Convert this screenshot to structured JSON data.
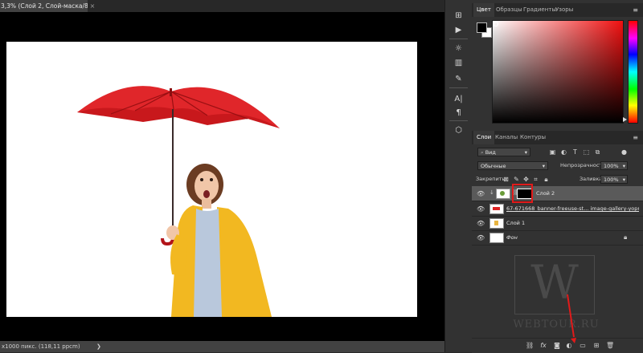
{
  "document": {
    "tab_title": "3,3% (Слой 2, Слой-маска/8) *",
    "close_symbol": "×",
    "status_text": "x1000 пикс. (118,11 ppcm)",
    "status_arrow": "❯"
  },
  "tool_dock": {
    "icons": [
      "history-icon",
      "play-action-icon",
      "adjustments-sun-icon",
      "histogram-icon",
      "brush-settings-icon",
      "character-A-icon",
      "paragraph-icon",
      "3d-cube-icon"
    ],
    "glyphs": {
      "history": "⊞",
      "play": "▶",
      "adjust": "☼",
      "histogram": "▥",
      "brush": "✎",
      "character": "A|",
      "paragraph": "¶",
      "cube": "⬡"
    }
  },
  "color_panel": {
    "tabs": [
      "Цвет",
      "Образцы",
      "Градиенты",
      "Узоры"
    ],
    "active_tab": "Цвет",
    "menu_symbol": "≡",
    "foreground_color": "#000000",
    "background_color": "#ffffff",
    "hue_color": "#f01010"
  },
  "layers_panel": {
    "tabs": [
      "Слои",
      "Каналы",
      "Контуры"
    ],
    "active_tab": "Слои",
    "menu_symbol": "≡",
    "filter_kind": "Вид",
    "blend_mode": "Обычные",
    "opacity_label": "Непрозрачность:",
    "opacity_value": "100%",
    "lock_label": "Закрепить:",
    "fill_label": "Заливка:",
    "fill_value": "100%",
    "layers": [
      {
        "name": "Слой 2",
        "selected": true,
        "has_mask": true
      },
      {
        "name": "67-671668_banner-freeuse-st... image-gallery-yopriceville...",
        "selected": false
      },
      {
        "name": "Слой 1",
        "selected": false
      },
      {
        "name": "Фон",
        "selected": false,
        "locked": true
      }
    ],
    "bottom_icons": [
      "link-icon",
      "fx-icon",
      "add-mask-icon",
      "adjustment-layer-icon",
      "new-group-icon",
      "new-layer-icon",
      "trash-icon"
    ],
    "fx_label": "fx"
  },
  "watermark": {
    "letter": "W",
    "text": "WEBTOUR.RU"
  },
  "colors": {
    "accent_red": "#e21a1a",
    "panel_bg": "#323232",
    "selected_row": "#5a5a5a"
  }
}
